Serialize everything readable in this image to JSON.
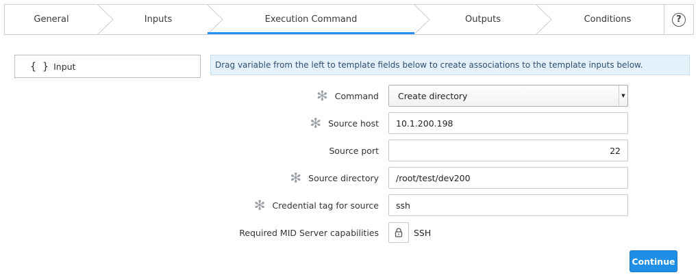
{
  "wizard": {
    "steps": [
      {
        "label": "General"
      },
      {
        "label": "Inputs"
      },
      {
        "label": "Execution Command",
        "active": true
      },
      {
        "label": "Outputs"
      },
      {
        "label": "Conditions"
      }
    ],
    "help_icon": "question-circle-icon",
    "active_color": "#278efc"
  },
  "left_panel": {
    "brace_glyph": "{ }",
    "label": "Input"
  },
  "banner": {
    "text": "Drag variable from the left to template fields below to create associations to the template inputs below."
  },
  "form": {
    "required_glyph": "✻",
    "command": {
      "label": "Command",
      "value": "Create directory"
    },
    "source_host": {
      "label": "Source host",
      "value": "10.1.200.198"
    },
    "source_port": {
      "label": "Source port",
      "value": "22"
    },
    "source_directory": {
      "label": "Source directory",
      "value": "/root/test/dev200"
    },
    "credential_tag": {
      "label": "Credential tag for source",
      "value": "ssh"
    },
    "mid_capabilities": {
      "label": "Required MID Server capabilities",
      "value": "SSH",
      "icon": "lock-icon"
    }
  },
  "actions": {
    "continue_label": "Continue",
    "accent": "#1e8ee6"
  }
}
